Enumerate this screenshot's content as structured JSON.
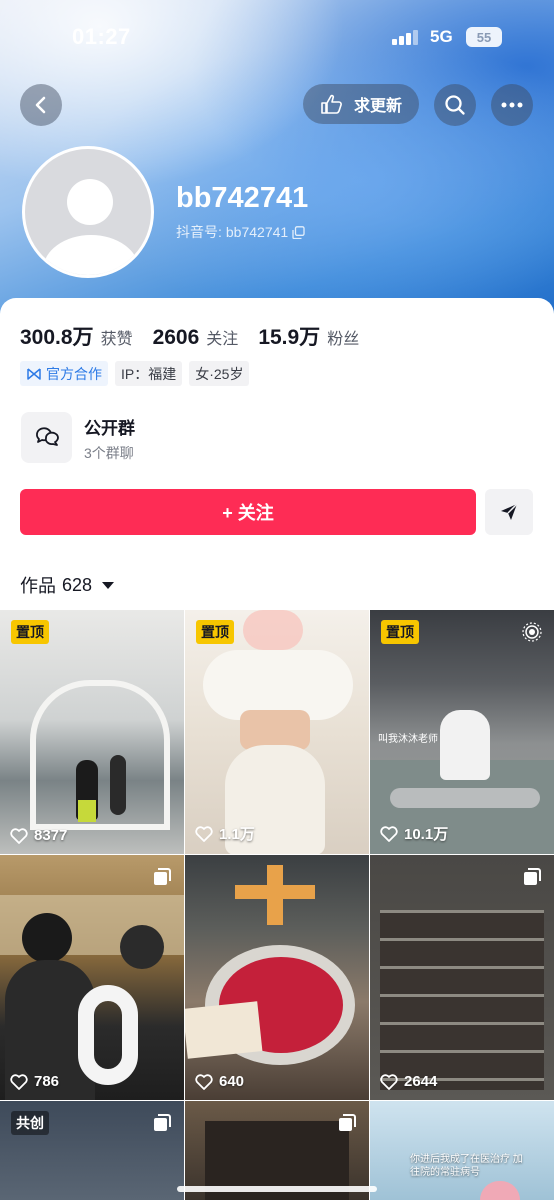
{
  "status_bar": {
    "time": "01:27",
    "network": "5G",
    "battery": "55"
  },
  "header": {
    "back_icon": "chevron-left-icon",
    "update_button_label": "求更新",
    "search_icon": "search-icon",
    "more_icon": "more-dots-icon"
  },
  "profile": {
    "username": "bb742741",
    "douyin_id_label": "抖音号:",
    "douyin_id": "bb742741"
  },
  "stats": [
    {
      "value": "300.8万",
      "label": "获赞"
    },
    {
      "value": "2606",
      "label": "关注"
    },
    {
      "value": "15.9万",
      "label": "粉丝"
    }
  ],
  "tags": [
    {
      "text": "官方合作",
      "icon": "official-badge-icon"
    },
    {
      "text": "IP：福建"
    },
    {
      "text": "女·25岁"
    }
  ],
  "group": {
    "title": "公开群",
    "subtitle": "3个群聊"
  },
  "actions": {
    "follow_label": "+ 关注",
    "message_icon": "send-message-icon"
  },
  "works": {
    "label": "作品",
    "count": "628"
  },
  "tiles": [
    {
      "badge": "置顶",
      "likes": "8377",
      "caption": ""
    },
    {
      "badge": "置顶",
      "likes": "1.1万",
      "caption": ""
    },
    {
      "badge": "置顶",
      "likes": "10.1万",
      "caption": "叫我沐沐老师"
    },
    {
      "badge": "",
      "likes": "786",
      "caption": ""
    },
    {
      "badge": "",
      "likes": "640",
      "caption": ""
    },
    {
      "badge": "",
      "likes": "2644",
      "caption": ""
    },
    {
      "badge": "共创",
      "likes": "",
      "caption": ""
    },
    {
      "badge": "",
      "likes": "",
      "caption": ""
    },
    {
      "badge": "",
      "likes": "",
      "caption": "你进后我成了在医治疗 加往院的常驻病号"
    }
  ],
  "colors": {
    "accent": "#fe2c55",
    "pinned_badge": "#f7c600",
    "official_blue": "#2e7be6"
  }
}
